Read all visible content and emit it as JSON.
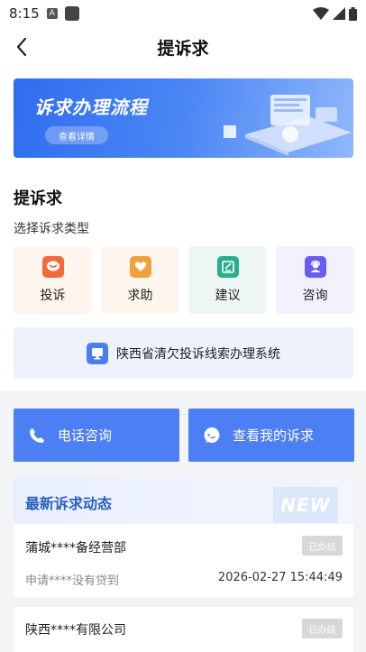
{
  "status_bar": {
    "time": "8:15",
    "notif_letter": "A"
  },
  "nav": {
    "title": "提诉求"
  },
  "banner": {
    "title": "诉求办理流程",
    "button_label": "查看详情"
  },
  "section": {
    "title": "提诉求",
    "subtitle": "选择诉求类型"
  },
  "types": [
    {
      "label": "投诉",
      "icon": "complaint-icon",
      "color": "#f06a3a",
      "bg": "#fdf5ee"
    },
    {
      "label": "求助",
      "icon": "help-icon",
      "color": "#f2a13a",
      "bg": "#fdf6ee"
    },
    {
      "label": "建议",
      "icon": "suggestion-icon",
      "color": "#27b08a",
      "bg": "#eef7f3"
    },
    {
      "label": "咨询",
      "icon": "consult-icon",
      "color": "#6a5cf0",
      "bg": "#f3f1fd"
    }
  ],
  "system": {
    "label": "陕西省清欠投诉线索办理系统",
    "icon": "monitor-icon"
  },
  "actions": {
    "phone_label": "电话咨询",
    "my_appeals_label": "查看我的诉求",
    "color": "#4b7ff3"
  },
  "feed": {
    "title": "最新诉求动态",
    "badge": "NEW",
    "items": [
      {
        "name": "蒲城****备经营部",
        "status": "已办结",
        "desc": "申请****没有贷到",
        "time": "2026-02-27 15:44:49"
      },
      {
        "name": "陕西****有限公司",
        "status": "已办结"
      }
    ]
  }
}
